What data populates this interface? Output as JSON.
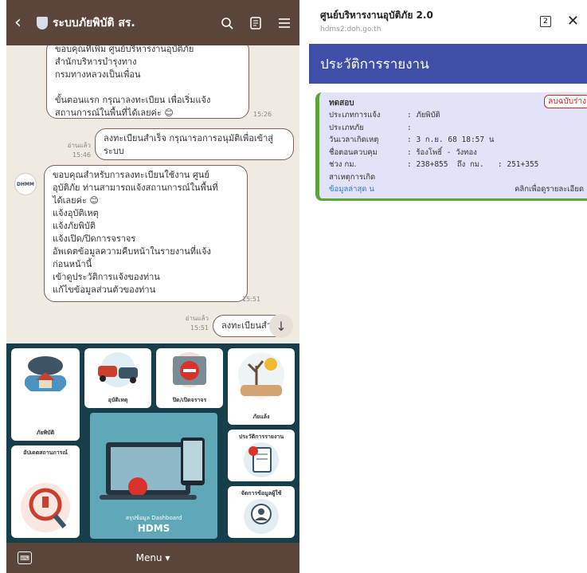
{
  "left": {
    "title": "ระบบภัยพิบัติ สร.",
    "bubble1": "ขอบคุณที่เพิ่ม ศูนย์บริหารงานอุบัติภัย\nสำนักบริหารบำรุงทาง\nกรมทางหลวงเป็นเพื่อน\n\nขั้นตอนแรก กรุณาลงทะเบียน เพื่อเริ่มแจ้ง\nสถานการณ์ในพื้นที่ได้เลยค่ะ 😊",
    "time1": "15:26",
    "bubble2": "ลงทะเบียนสำเร็จ กรุณารอการอนุมัติเพื่อเข้าสู่\nระบบ",
    "read2": "อ่านแล้ว",
    "time2": "15:46",
    "avatar": "DHMM",
    "bubble3": "ขอบคุณสำหรับการลงทะเบียนใช้งาน ศูนย์\nอุบัติภัย ท่านสามารถแจ้งสถานการณ์ในพื้นที่\nได้เลยค่ะ 😊\nแจ้งอุบัติเหตุ\nแจ้งภัยพิบัติ\nแจ้งเปิด/ปิดการจราจร\nอัพเดตข้อมูลความคืบหน้าในรายงานที่แจ้ง\nก่อนหน้านี้\nเข้าดูประวัติการแจ้งของท่าน\nแก้ไขข้อมูลส่วนตัวของท่าน",
    "time3": "15:51",
    "bubble4": "ลงทะเบียนสำ",
    "read4": "อ่านแล้ว",
    "time4": "15:51",
    "menu": {
      "disaster": "ภัยพิบัติ",
      "accident": "อุบัติเหตุ",
      "road": "ปิด/เปิดจราจร",
      "drought": "ภัยแล้ง",
      "update": "อัปเดตสถานการณ์",
      "history": "ประวัติการรายงาน",
      "manage": "จัดการข้อมูลผู้ใช้",
      "dash": "สรุปข้อมูล Dashboard",
      "hdms": "HDMS"
    },
    "bottom_menu": "Menu ▾"
  },
  "right": {
    "title": "ศูนย์บริหารงานอุบัติภัย 2.0",
    "url": "hdms2.doh.go.th",
    "tabs": "2",
    "band": "ประวัติการรายงาน",
    "card": {
      "name": "ทดสอบ",
      "badge": "ลบฉบับร่าง",
      "rows": [
        {
          "k": "ประเภทการแจ้ง",
          "v": ": ภัยพิบัติ"
        },
        {
          "k": "ประเภทภัย",
          "v": ":"
        },
        {
          "k": "วันเวลาเกิดเหตุ",
          "v": ": 3 ก.ย. 68 18:57 น"
        },
        {
          "k": "ชื่อตอนควบคุม",
          "v": ": ร้องโพธิ์ - วังทอง"
        },
        {
          "k": "ช่วง กม.",
          "v": ": 238+855  ถึง กม.   : 251+355"
        },
        {
          "k": "สาเหตุการเกิด",
          "v": ""
        }
      ],
      "foot_left": "ข้อมูลล่าสุด  น",
      "foot_right": "คลิกเพื่อดูรายละเอียด"
    }
  }
}
